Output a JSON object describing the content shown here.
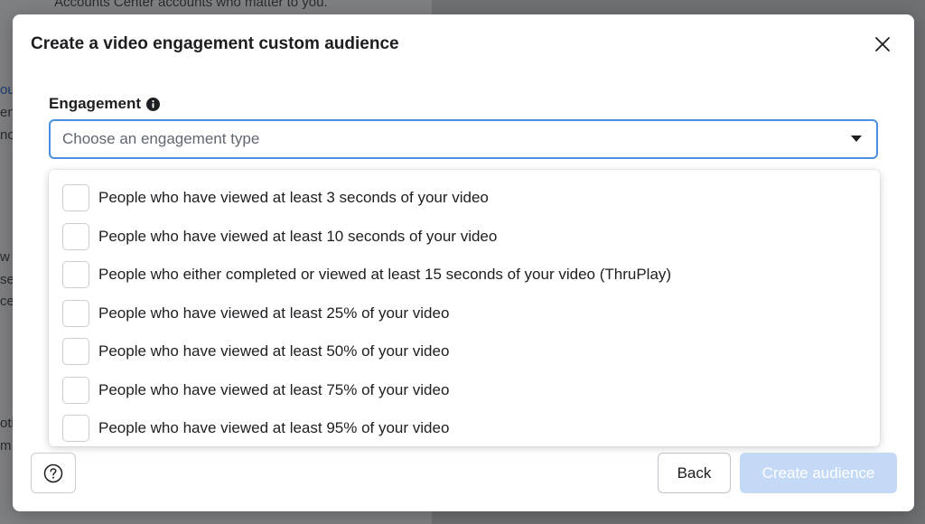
{
  "background": {
    "top_text": "Accounts Center accounts who matter to you.",
    "fragments": [
      "ou",
      "en",
      "no",
      "w",
      "se",
      "ce",
      "oti",
      "m"
    ]
  },
  "modal": {
    "title": "Create a video engagement custom audience",
    "close_icon": "close-icon"
  },
  "engagement": {
    "label": "Engagement",
    "info_icon": "info-icon",
    "placeholder": "Choose an engagement type",
    "caret_icon": "caret-down-icon"
  },
  "options": [
    {
      "label": "People who have viewed at least 3 seconds of your video",
      "checked": false
    },
    {
      "label": "People who have viewed at least 10 seconds of your video",
      "checked": false
    },
    {
      "label": "People who either completed or viewed at least 15 seconds of your video (ThruPlay)",
      "checked": false
    },
    {
      "label": "People who have viewed at least 25% of your video",
      "checked": false
    },
    {
      "label": "People who have viewed at least 50% of your video",
      "checked": false
    },
    {
      "label": "People who have viewed at least 75% of your video",
      "checked": false
    },
    {
      "label": "People who have viewed at least 95% of your video",
      "checked": false
    }
  ],
  "footer": {
    "help_icon": "question-icon",
    "back_label": "Back",
    "create_label": "Create audience"
  },
  "colors": {
    "focus_border": "#4a90e2",
    "create_disabled_bg": "#c3d9f5"
  }
}
